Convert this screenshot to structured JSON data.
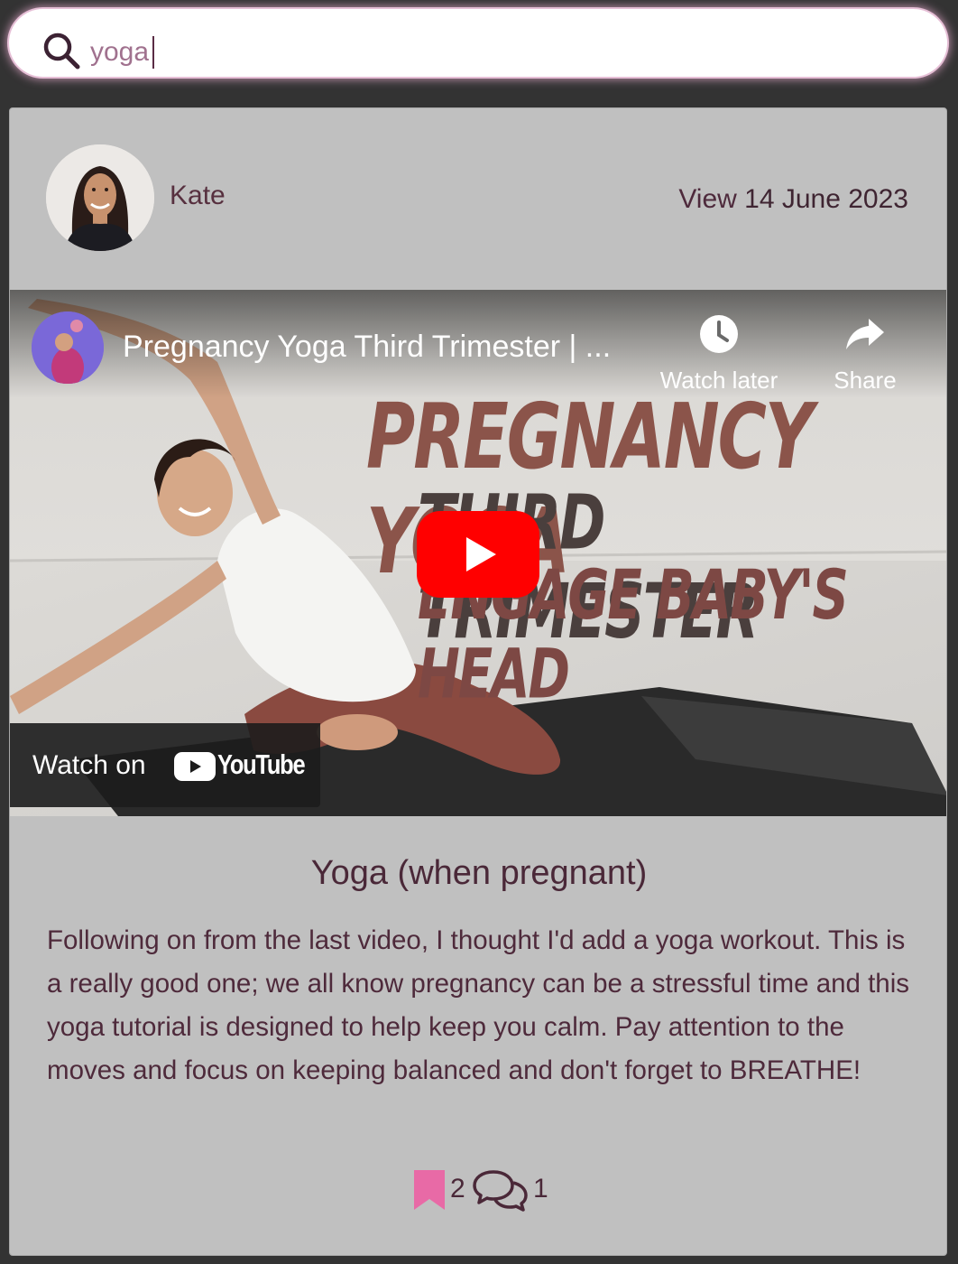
{
  "search": {
    "query": "yoga",
    "placeholder": ""
  },
  "post": {
    "author": "Kate",
    "date_prefix": "View",
    "date": "14 June 2023",
    "title": "Yoga (when pregnant)",
    "body": "Following on from the last video, I thought I'd add a yoga workout. This is a really good one; we all know pregnancy can be a stressful time and this yoga tutorial is designed to help keep you calm. Pay attention to the moves and focus on keeping balanced and don't forget to BREATHE!",
    "bookmark_count": "2",
    "comment_count": "1"
  },
  "video": {
    "title": "Pregnancy Yoga Third Trimester | ...",
    "watch_later": "Watch later",
    "share": "Share",
    "thumbnail_line1": "PREGNANCY YOGA",
    "thumbnail_line2": "THIRD TRIMESTER",
    "thumbnail_line3": "ENGAGE BABY'S HEAD",
    "watch_on": "Watch on",
    "youtube": "YouTube"
  },
  "colors": {
    "accent_pink": "#e86aa6",
    "text_plum": "#4e2a3b",
    "card_bg": "#c0c0c0",
    "page_bg": "#333333",
    "youtube_red": "#ff0000"
  },
  "icons": {
    "search": "search-icon",
    "bookmark": "bookmark-icon",
    "comments": "comments-icon",
    "clock": "clock-icon",
    "share": "share-arrow-icon",
    "play": "play-icon"
  }
}
